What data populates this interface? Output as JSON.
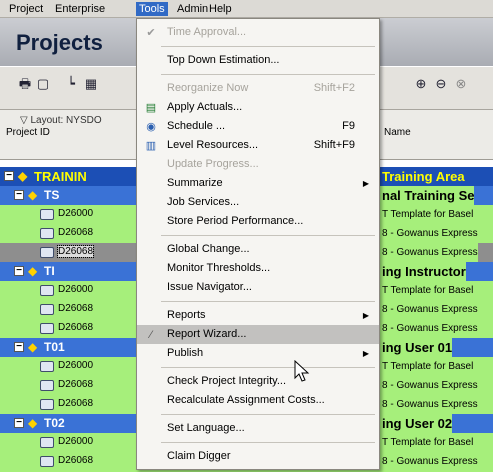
{
  "menubar": [
    "Project",
    "Enterprise",
    "Tools",
    "Admin",
    "Help"
  ],
  "header": {
    "title": "Projects"
  },
  "grid": {
    "layout_label": "Layout: NYSDO",
    "col_project_id": "Project ID",
    "col_name": "Name",
    "rows": [
      {
        "kind": "root",
        "label": "TRAININ",
        "name": "Training Area"
      },
      {
        "kind": "group",
        "label": "TS",
        "name": "nal Training Se"
      },
      {
        "kind": "project",
        "id": "D26000",
        "name": "T Template for Basel"
      },
      {
        "kind": "project",
        "id": "D26068",
        "name": "8 - Gowanus Express"
      },
      {
        "kind": "project-selected",
        "id": "D26068",
        "name": "8 - Gowanus Express"
      },
      {
        "kind": "group",
        "label": "TI",
        "name": "ing Instructor"
      },
      {
        "kind": "project",
        "id": "D26000",
        "name": "T Template for Basel"
      },
      {
        "kind": "project",
        "id": "D26068",
        "name": "8 - Gowanus Express"
      },
      {
        "kind": "project",
        "id": "D26068",
        "name": "8 - Gowanus Express"
      },
      {
        "kind": "group",
        "label": "T01",
        "name": "ing User 01"
      },
      {
        "kind": "project",
        "id": "D26000",
        "name": "T Template for Basel"
      },
      {
        "kind": "project",
        "id": "D26068",
        "name": "8 - Gowanus Express"
      },
      {
        "kind": "project",
        "id": "D26068",
        "name": "8 - Gowanus Express"
      },
      {
        "kind": "group",
        "label": "T02",
        "name": "ing User 02"
      },
      {
        "kind": "project",
        "id": "D26000",
        "name": "T Template for Basel"
      },
      {
        "kind": "project",
        "id": "D26068",
        "name": "8 - Gowanus Express"
      }
    ]
  },
  "tools_menu": {
    "items": [
      {
        "label": "Time Approval...",
        "disabled": true,
        "icon": "check-icon"
      },
      {
        "label": "Top Down Estimation...",
        "disabled": false
      },
      {
        "label": "Reorganize Now",
        "shortcut": "Shift+F2",
        "disabled": true
      },
      {
        "label": "Apply Actuals...",
        "disabled": false,
        "icon": "apply-actuals-icon"
      },
      {
        "label": "Schedule ...",
        "shortcut": "F9",
        "disabled": false,
        "icon": "schedule-icon"
      },
      {
        "label": "Level Resources...",
        "shortcut": "Shift+F9",
        "disabled": false,
        "icon": "level-resources-icon"
      },
      {
        "label": "Update Progress...",
        "disabled": true
      },
      {
        "label": "Summarize",
        "disabled": false,
        "submenu": true
      },
      {
        "label": "Job Services...",
        "disabled": false
      },
      {
        "label": "Store Period Performance...",
        "disabled": false
      },
      {
        "label": "Global Change...",
        "disabled": false
      },
      {
        "label": "Monitor Thresholds...",
        "disabled": false
      },
      {
        "label": "Issue Navigator...",
        "disabled": false
      },
      {
        "label": "Reports",
        "disabled": false,
        "submenu": true
      },
      {
        "label": "Report Wizard...",
        "disabled": false,
        "highlighted": true,
        "icon": "wand-icon"
      },
      {
        "label": "Publish",
        "disabled": false,
        "submenu": true
      },
      {
        "label": "Check Project Integrity...",
        "disabled": false
      },
      {
        "label": "Recalculate Assignment Costs...",
        "disabled": false
      },
      {
        "label": "Set Language...",
        "disabled": false
      },
      {
        "label": "Claim Digger",
        "disabled": false
      }
    ]
  }
}
